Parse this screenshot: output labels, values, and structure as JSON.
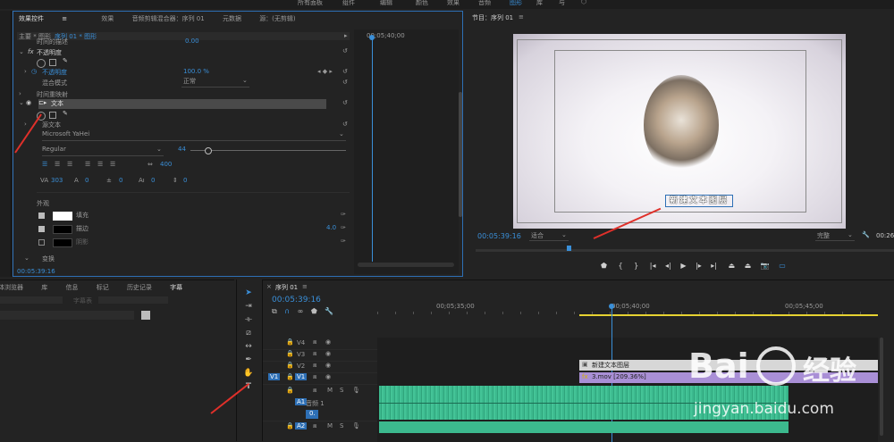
{
  "top_menu": [
    "所有面板",
    "组件",
    "编辑",
    "颜色",
    "效果",
    "音频",
    "图形",
    "库",
    "与",
    "⬡"
  ],
  "effect_controls": {
    "tabs": [
      "效果控件",
      "效果",
      "音频剪辑混合器：序列 01",
      "元数据",
      "源：(无剪辑)"
    ],
    "active_tab_symbol": "≡",
    "clip_path": "主要 * 图形",
    "clip_sequence": "序列 01 * 图形",
    "timecode_ruler": "00;05;40;00",
    "rows": {
      "collapsed_top": "时间的描述",
      "collapsed_top_value": "0.00",
      "opacity_group": "不透明度",
      "opacity_label": "不透明度",
      "opacity_value": "100.0 %",
      "blend_label": "混合模式",
      "blend_value": "正常",
      "time_remap": "时间重映射",
      "text_layer": "文本",
      "source_text": "源文本",
      "font": "Microsoft YaHei",
      "style": "Regular",
      "size_value": "44",
      "tracking_value": "400",
      "metric_values": [
        "303",
        "0",
        "0",
        "0",
        "0"
      ],
      "appearance": "外观",
      "fill_label": "填充",
      "stroke_label": "描边",
      "stroke_value": "4.0",
      "shadow_label": "阴影",
      "transform": "变换",
      "bottom_timecode": "00:05:39:16"
    }
  },
  "program_monitor": {
    "title": "节目：序列 01",
    "text_overlay": "新建文本图层",
    "timecode": "00:05:39:16",
    "fit": "适合",
    "quality": "完整",
    "right_timecode": "00:26"
  },
  "left_bottom": {
    "tabs": [
      "体浏览器",
      "库",
      "信息",
      "标记",
      "历史记录",
      "字幕"
    ],
    "field_label": "字幕表"
  },
  "timeline": {
    "title": "序列 01",
    "timecode": "00:05:39:16",
    "ruler_labels": [
      "00;05;35;00",
      "00;05;40;00",
      "00;05;45;00"
    ],
    "tracks": [
      "V4",
      "V3",
      "V2",
      "V1",
      "A1",
      "A2"
    ],
    "v1_source": "V1",
    "a1_sub": "音频 1",
    "clip_text": "新建文本图层",
    "clip_video": "3.mov [209.36%]"
  },
  "watermark": {
    "brand": "Bai",
    "brand2": "经验",
    "url": "jingyan.baidu.com"
  },
  "colors": {
    "accent": "#3a8fd8",
    "arrow": "#e0302a",
    "audio_clip": "#3cb98e",
    "video_clip": "#a98fd6",
    "text_clip": "#d7d7d7"
  }
}
